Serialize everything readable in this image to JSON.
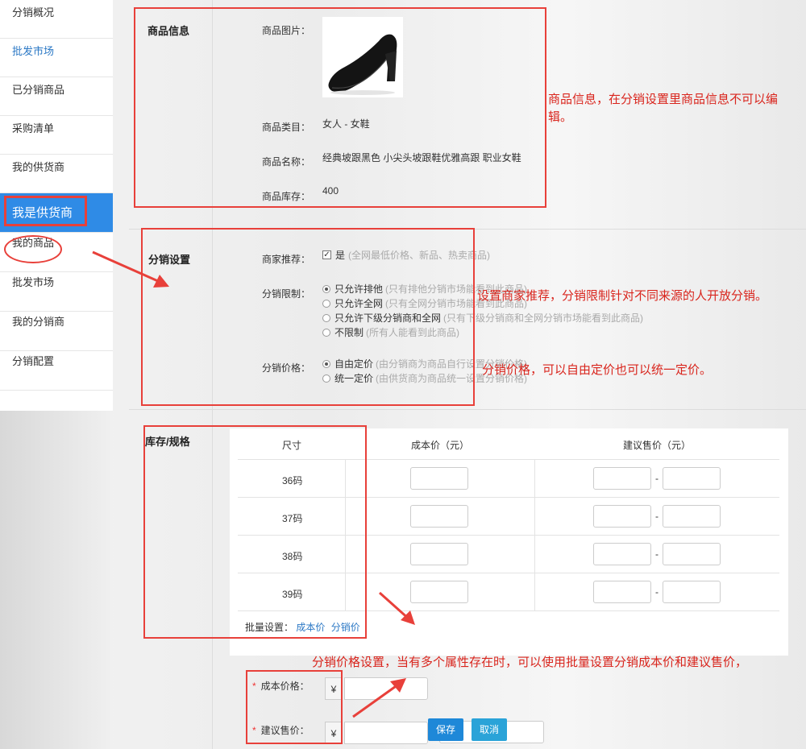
{
  "sidebar": {
    "top_items": [
      "分销概况",
      "批发市场",
      "已分销商品",
      "采购清单",
      "我的供货商"
    ],
    "active": "我是供货商",
    "sub_items": [
      "我的商品",
      "批发市场",
      "我的分销商",
      "分销配置"
    ]
  },
  "product_info": {
    "title": "商品信息",
    "image_label": "商品图片：",
    "category_label": "商品类目：",
    "category_value": "女人 - 女鞋",
    "name_label": "商品名称：",
    "name_value": "经典坡跟黑色 小尖头坡跟鞋优雅高跟 职业女鞋",
    "stock_label": "商品库存：",
    "stock_value": "400"
  },
  "distribution": {
    "title": "分销设置",
    "recommend_label": "商家推荐：",
    "recommend_yes": "是",
    "recommend_hint": "(全网最低价格、新品、热卖商品)",
    "limit_label": "分销限制：",
    "limit_options": [
      {
        "label": "只允许排他",
        "hint": "(只有排他分销市场能看到此商品)"
      },
      {
        "label": "只允许全网",
        "hint": "(只有全网分销市场能看到此商品)"
      },
      {
        "label": "只允许下级分销商和全网",
        "hint": "(只有下级分销商和全网分销市场能看到此商品)"
      },
      {
        "label": "不限制",
        "hint": "(所有人能看到此商品)"
      }
    ],
    "price_label": "分销价格：",
    "price_options": [
      {
        "label": "自由定价",
        "hint": "(由分销商为商品自行设置分销价格)"
      },
      {
        "label": "统一定价",
        "hint": "(由供货商为商品统一设置分销价格)"
      }
    ]
  },
  "stock_spec": {
    "title": "库存/规格",
    "headers": [
      "尺寸",
      "成本价（元）",
      "建议售价（元）"
    ],
    "sizes": [
      "36码",
      "37码",
      "38码",
      "39码"
    ],
    "dash": "-",
    "batch_label": "批量设置：",
    "batch_cost": "成本价",
    "batch_dist": "分销价",
    "star": "*",
    "cost_price_label": "成本价格：",
    "suggest_price_label": "建议售价：",
    "yen": "¥",
    "save_label": "保存",
    "cancel_label": "取消"
  },
  "annotations": {
    "note1": "商品信息，在分销设置里商品信息不可以编辑。",
    "note2": "设置商家推荐，分销限制针对不同来源的人开放分销。",
    "note3": "分销价格，可以自由定价也可以统一定价。",
    "note4": "分销价格设置，当有多个属性存在时，可以使用批量设置分销成本价和建议售价，"
  },
  "colors": {
    "accent": "#2f8be6",
    "annotation_red": "#e8403a",
    "button_blue": "#1e88d8",
    "link_blue": "#2b78c5"
  }
}
